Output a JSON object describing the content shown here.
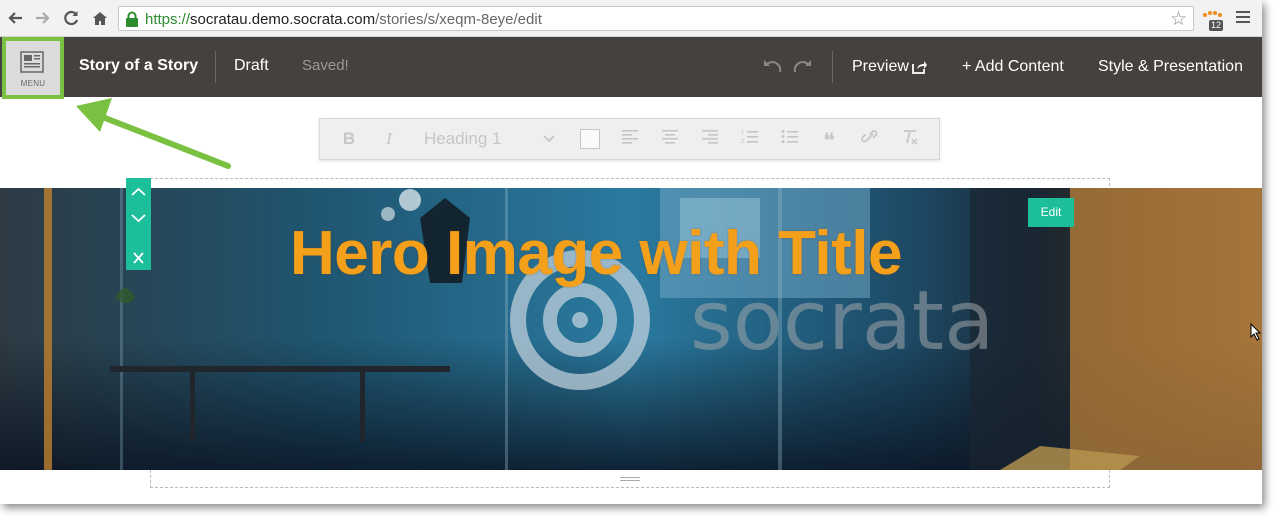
{
  "browser": {
    "url_protocol": "https://",
    "url_host": "socratau.demo.socrata.com",
    "url_path": "/stories/s/xeqm-8eye/edit",
    "extension_badge": "12",
    "icons": [
      "back-icon",
      "forward-icon",
      "reload-icon",
      "home-icon",
      "lock-icon",
      "star-icon",
      "extension-icon",
      "menu-icon"
    ]
  },
  "appbar": {
    "menu_label": "MENU",
    "story_title": "Story of a Story",
    "status": "Draft",
    "save_state": "Saved!",
    "preview_label": "Preview",
    "add_content_label": "+ Add Content",
    "style_label": "Style & Presentation",
    "menu_highlight_color": "#7ac142",
    "background_color": "#45413e"
  },
  "format_toolbar": {
    "bold": "B",
    "italic": "I",
    "heading_value": "Heading 1",
    "quote": "❝"
  },
  "hero": {
    "title": "Hero Image with Title",
    "watermark_text": "socrata",
    "edit_label": "Edit",
    "title_color": "#f5a01a",
    "accent_color": "#1cbf9a"
  },
  "block_controls": [
    "move-up-icon",
    "move-down-icon",
    "delete-icon"
  ]
}
